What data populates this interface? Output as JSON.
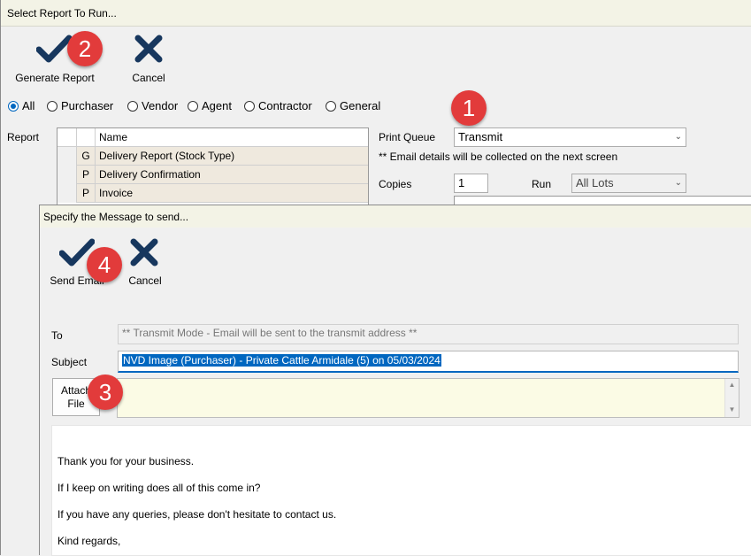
{
  "outer": {
    "title": "Select Report To Run...",
    "toolbar": {
      "generate_label": "Generate Report",
      "cancel_label": "Cancel"
    },
    "filters": [
      {
        "label": "All",
        "selected": true
      },
      {
        "label": "Purchaser",
        "selected": false
      },
      {
        "label": "Vendor",
        "selected": false
      },
      {
        "label": "Agent",
        "selected": false
      },
      {
        "label": "Contractor",
        "selected": false
      },
      {
        "label": "General",
        "selected": false
      }
    ],
    "report_label": "Report",
    "report_grid": {
      "header": {
        "name": "Name"
      },
      "rows": [
        {
          "type": "G",
          "name": "Delivery Report (Stock Type)"
        },
        {
          "type": "P",
          "name": "Delivery Confirmation"
        },
        {
          "type": "P",
          "name": "Invoice"
        }
      ]
    },
    "print_queue_label": "Print Queue",
    "print_queue_value": "Transmit",
    "email_note": "** Email details will be collected on the next screen",
    "copies_label": "Copies",
    "copies_value": "1",
    "run_label": "Run",
    "run_value": "All Lots"
  },
  "inner": {
    "title": "Specify the Message to send...",
    "toolbar": {
      "send_label": "Send Email",
      "cancel_label": "Cancel"
    },
    "to_label": "To",
    "to_value": "** Transmit Mode - Email will be sent to the transmit address **",
    "subject_label": "Subject",
    "subject_value": "NVD Image (Purchaser) - Private Cattle Armidale (5) on 05/03/2024",
    "attach_line1": "Attach",
    "attach_line2": "File",
    "body_lines": [
      "Thank you for your business.",
      "If I keep on writing does all of this come in?",
      "If you have any queries, please don't hesitate to contact us.",
      "Kind regards,"
    ]
  },
  "annotations": [
    "1",
    "2",
    "3",
    "4"
  ],
  "colors": {
    "accent": "#0067c0",
    "icon_navy": "#17375e",
    "annotation_red": "#e23b3b",
    "title_bar": "#f3f3e6"
  }
}
